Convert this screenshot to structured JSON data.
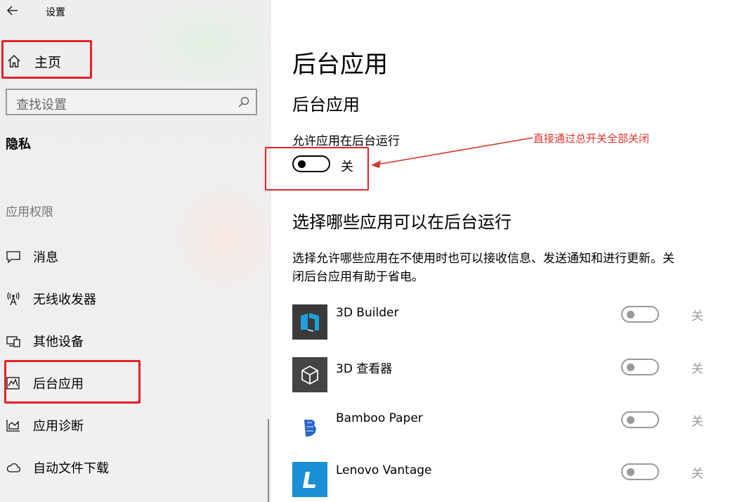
{
  "window": {
    "title": "设置"
  },
  "sidebar": {
    "home_label": "主页",
    "search_placeholder": "查找设置",
    "section_title": "隐私",
    "group_title": "应用权限",
    "items": [
      {
        "label": "消息",
        "icon": "message-icon"
      },
      {
        "label": "无线收发器",
        "icon": "radio-antenna-icon"
      },
      {
        "label": "其他设备",
        "icon": "devices-icon"
      },
      {
        "label": "后台应用",
        "icon": "background-apps-icon",
        "selected": true
      },
      {
        "label": "应用诊断",
        "icon": "diagnostics-chart-icon"
      },
      {
        "label": "自动文件下载",
        "icon": "cloud-icon"
      }
    ]
  },
  "main": {
    "page_title": "后台应用",
    "section_title": "后台应用",
    "allow_label": "允许应用在后台运行",
    "master_toggle_state": "关",
    "annotation": "直接通过总开关全部关闭",
    "choose_title": "选择哪些应用可以在后台运行",
    "description": "选择允许哪些应用在不使用时也可以接收信息、发送通知和进行更新。关闭后台应用有助于省电。",
    "apps": [
      {
        "name": "3D Builder",
        "state": "关",
        "icon": "3d-builder-icon",
        "color": "#3a3a3a"
      },
      {
        "name": "3D 查看器",
        "state": "关",
        "icon": "3d-viewer-cube-icon",
        "color": "#444444"
      },
      {
        "name": "Bamboo Paper",
        "state": "关",
        "icon": "bamboo-paper-icon",
        "color": "#ffffff"
      },
      {
        "name": "Lenovo Vantage",
        "state": "关",
        "icon": "lenovo-vantage-icon",
        "color": "#1a8fd6"
      }
    ]
  },
  "colors": {
    "highlight_box": "#e8202a",
    "annotation": "#d9342f",
    "toggle_off": "#9a9a9a"
  }
}
